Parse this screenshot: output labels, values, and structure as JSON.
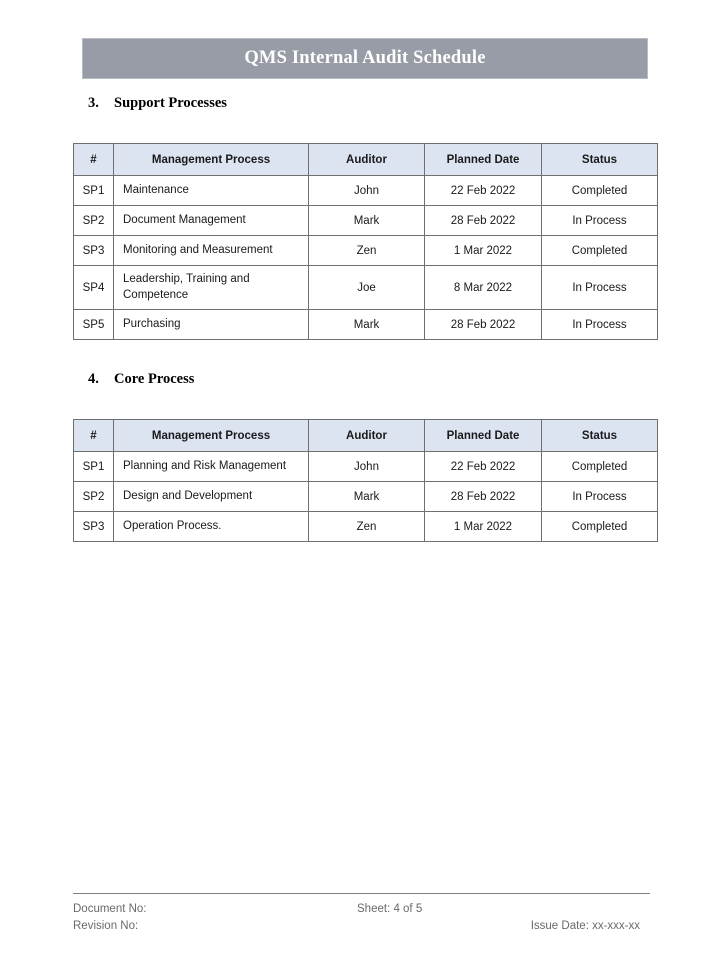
{
  "document": {
    "title": "QMS Internal Audit Schedule"
  },
  "sections": [
    {
      "number": "3.",
      "label": "Support Processes",
      "table": {
        "columns": [
          "#",
          "Management Process",
          "Auditor",
          "Planned Date",
          "Status"
        ],
        "rows": [
          {
            "num": "SP1",
            "process": "Maintenance",
            "auditor": "John",
            "date": "22 Feb 2022",
            "status": "Completed",
            "tall": false
          },
          {
            "num": "SP2",
            "process": "Document Management",
            "auditor": "Mark",
            "date": "28 Feb 2022",
            "status": "In Process",
            "tall": false
          },
          {
            "num": "SP3",
            "process": "Monitoring and Measurement",
            "auditor": "Zen",
            "date": "1 Mar 2022",
            "status": "Completed",
            "tall": false
          },
          {
            "num": "SP4",
            "process": "Leadership, Training and Competence",
            "auditor": "Joe",
            "date": "8 Mar 2022",
            "status": "In Process",
            "tall": true
          },
          {
            "num": "SP5",
            "process": "Purchasing",
            "auditor": "Mark",
            "date": "28 Feb 2022",
            "status": "In Process",
            "tall": false
          }
        ]
      }
    },
    {
      "number": "4.",
      "label": "Core Process",
      "table": {
        "columns": [
          "#",
          "Management Process",
          "Auditor",
          "Planned Date",
          "Status"
        ],
        "rows": [
          {
            "num": "SP1",
            "process": "Planning and Risk Management",
            "auditor": "John",
            "date": "22 Feb 2022",
            "status": "Completed",
            "tall": false
          },
          {
            "num": "SP2",
            "process": "Design and Development",
            "auditor": "Mark",
            "date": "28 Feb 2022",
            "status": "In Process",
            "tall": false
          },
          {
            "num": "SP3",
            "process": "Operation Process.",
            "auditor": "Zen",
            "date": "1 Mar 2022",
            "status": "Completed",
            "tall": false
          }
        ]
      }
    }
  ],
  "footer": {
    "document_no": "Document No:",
    "revision_no": "Revision No:",
    "sheet": "Sheet: 4 of 5",
    "issue_date": "Issue Date: xx-xxx-xx"
  },
  "colors": {
    "banner_background": "#989ca6",
    "banner_text": "#ffffff",
    "table_header_background": "#dce3f1",
    "table_border": "#6f6f6f",
    "footer_text": "#6a6a6a"
  }
}
